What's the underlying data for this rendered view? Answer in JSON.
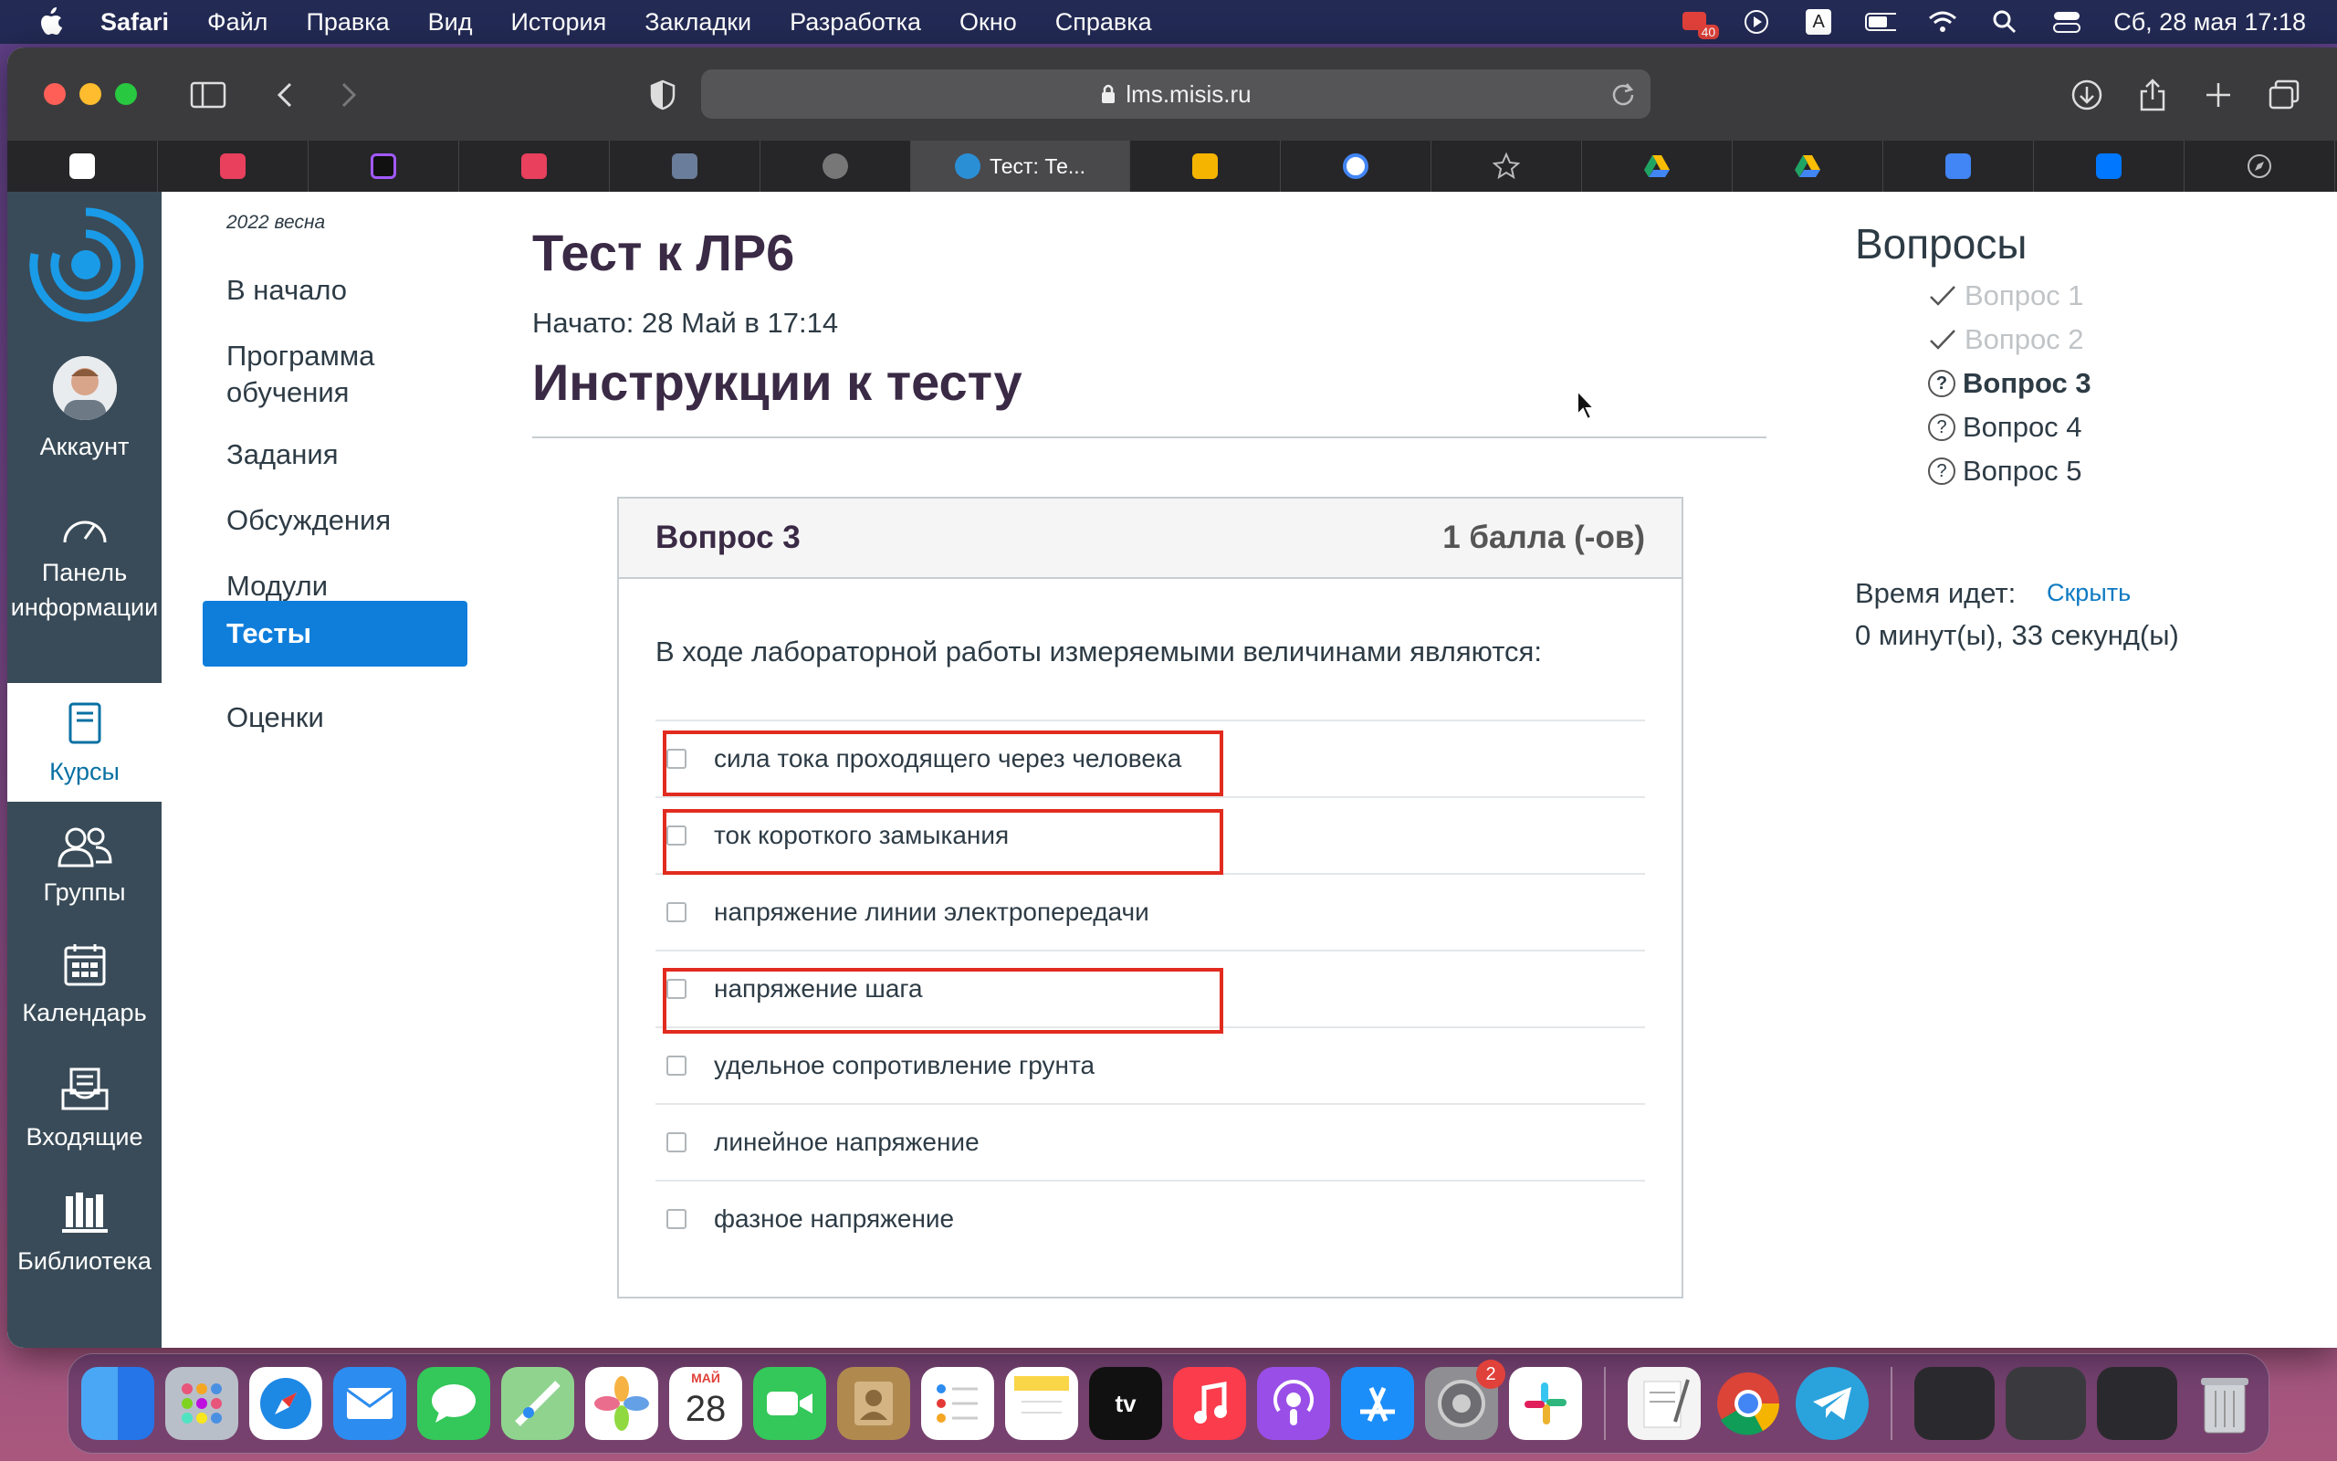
{
  "menubar": {
    "app": "Safari",
    "items": [
      "Файл",
      "Правка",
      "Вид",
      "История",
      "Закладки",
      "Разработка",
      "Окно",
      "Справка"
    ],
    "battery_badge": "40",
    "input_indicator": "A",
    "datetime": "Сб, 28 мая  17:18"
  },
  "browser": {
    "url": "lms.misis.ru",
    "active_tab": "Тест: Те..."
  },
  "global_nav": {
    "account": "Аккаунт",
    "dashboard": "Панель информации",
    "courses": "Курсы",
    "groups": "Группы",
    "calendar": "Календарь",
    "inbox": "Входящие",
    "library": "Библиотека"
  },
  "course_nav": {
    "term": "2022 весна",
    "items": [
      "В начало",
      "Программа обучения",
      "Задания",
      "Обсуждения",
      "Модули",
      "Тесты",
      "Оценки"
    ],
    "active": "Тесты"
  },
  "quiz": {
    "title": "Тест к ЛР6",
    "started": "Начато: 28 Май в 17:14",
    "instructions_heading": "Инструкции к тесту",
    "question_label": "Вопрос 3",
    "points": "1 балла (-ов)",
    "question_text": "В ходе лабораторной работы измеряемыми величинами являются:",
    "answers": [
      "сила тока проходящего через человека",
      "ток короткого замыкания",
      "напряжение линии электропередачи",
      "напряжение шага",
      "удельное сопротивление грунта",
      "линейное напряжение",
      "фазное напряжение"
    ]
  },
  "sidebar": {
    "questions_title": "Вопросы",
    "questions": [
      "Вопрос 1",
      "Вопрос 2",
      "Вопрос 3",
      "Вопрос 4",
      "Вопрос 5"
    ],
    "timer_label": "Время идет:",
    "hide_link": "Скрыть",
    "timer_value": "0 минут(ы), 33 секунд(ы)"
  },
  "dock": {
    "calendar_month": "МАЙ",
    "calendar_day": "28",
    "settings_badge": "2",
    "tv_label": "tv"
  },
  "colors": {
    "accent": "#0f7edb",
    "global_nav": "#394b58",
    "highlight": "#e22b1f"
  }
}
